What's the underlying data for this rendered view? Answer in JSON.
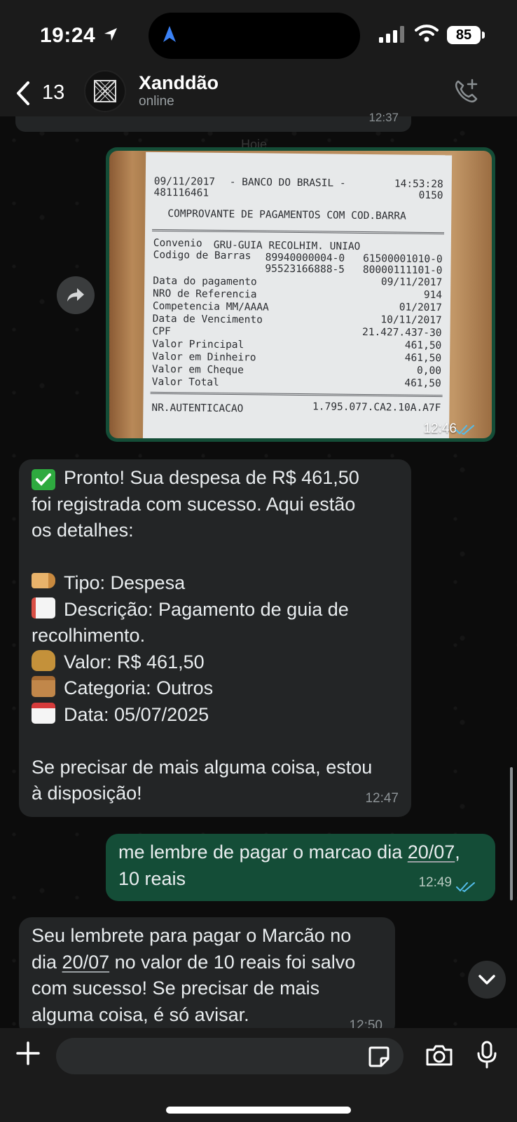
{
  "status_bar": {
    "time": "19:24",
    "battery": "85"
  },
  "header": {
    "back_count": "13",
    "contact_name": "Xanddão",
    "contact_status": "online"
  },
  "previous_message": {
    "time": "12:37"
  },
  "date_divider": "Hoje",
  "image_message": {
    "time": "12:46",
    "receipt": {
      "date": "09/11/2017",
      "bank": "- BANCO DO BRASIL -",
      "hour": "14:53:28",
      "id": "481116461",
      "code": "0150",
      "title": "COMPROVANTE DE PAGAMENTOS COM COD.BARRA",
      "convenio_label": "Convenio",
      "convenio_value": "GRU-GUIA RECOLHIM. UNIAO",
      "barcode_label": "Codigo de Barras",
      "barcode_1a": "89940000004-0",
      "barcode_1b": "61500001010-0",
      "barcode_2a": "95523166888-5",
      "barcode_2b": "80000111101-0",
      "rows": [
        {
          "label": "Data do pagamento",
          "value": "09/11/2017"
        },
        {
          "label": "NRO de Referencia",
          "value": "914"
        },
        {
          "label": "Competencia MM/AAAA",
          "value": "01/2017"
        },
        {
          "label": "Data de Vencimento",
          "value": "10/11/2017"
        },
        {
          "label": "CPF",
          "value": "21.427.437-30"
        },
        {
          "label": "Valor Principal",
          "value": "461,50"
        },
        {
          "label": "Valor em Dinheiro",
          "value": "461,50"
        },
        {
          "label": "Valor em Cheque",
          "value": "0,00"
        },
        {
          "label": "Valor Total",
          "value": "461,50"
        }
      ],
      "auth_label": "NR.AUTENTICACAO",
      "auth_value": "1.795.077.CA2.10A.A7F"
    }
  },
  "bot_message_1": {
    "line1": "Pronto! Sua despesa de R$ 461,50",
    "line2": "foi registrada com sucesso. Aqui estão",
    "line3": "os detalhes:",
    "tipo": "Tipo: Despesa",
    "descricao1": "Descrição: Pagamento de guia de",
    "descricao2": "recolhimento.",
    "valor": "Valor: R$ 461,50",
    "categoria": "Categoria: Outros",
    "data": "Data: 05/07/2025",
    "closing1": "Se precisar de mais alguma coisa, estou",
    "closing2": "à disposição!",
    "time": "12:47"
  },
  "user_message": {
    "line1_pre": "me lembre de pagar o marcao dia ",
    "line1_date": "20/07",
    "line1_post": ",",
    "line2": "10 reais",
    "time": "12:49"
  },
  "bot_message_2": {
    "line1": "Seu lembrete para pagar o Marcão no",
    "line2_pre": "dia ",
    "line2_date": "20/07",
    "line2_post": " no valor de 10 reais foi salvo",
    "line3": "com sucesso! Se precisar de mais",
    "line4": "alguma coisa, é só avisar.",
    "time": "12:50"
  },
  "input": {
    "placeholder": ""
  },
  "colors": {
    "outgoing_bubble": "#144d37",
    "incoming_bubble": "#232526",
    "read_ticks": "#53bdeb"
  }
}
